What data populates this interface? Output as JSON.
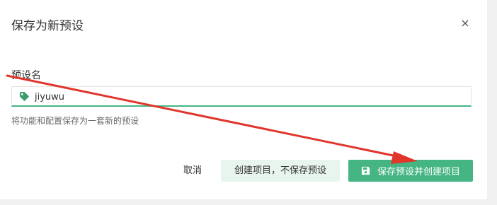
{
  "dialog": {
    "title": "保存为新预设",
    "close_label": "×",
    "field_label": "预设名",
    "input_value": "jiyuwu",
    "hint": "将功能和配置保存为一套新的预设",
    "buttons": {
      "cancel": "取消",
      "create_no_save": "创建项目，不保存预设",
      "save_and_create": "保存预设并创建项目"
    }
  },
  "icons": {
    "tag": "tag-icon",
    "save": "floppy-disk-icon",
    "close": "close-icon"
  },
  "colors": {
    "accent": "#45b584",
    "secondary_button_bg": "#e8f5ee",
    "annotation_arrow": "#e0362c"
  }
}
